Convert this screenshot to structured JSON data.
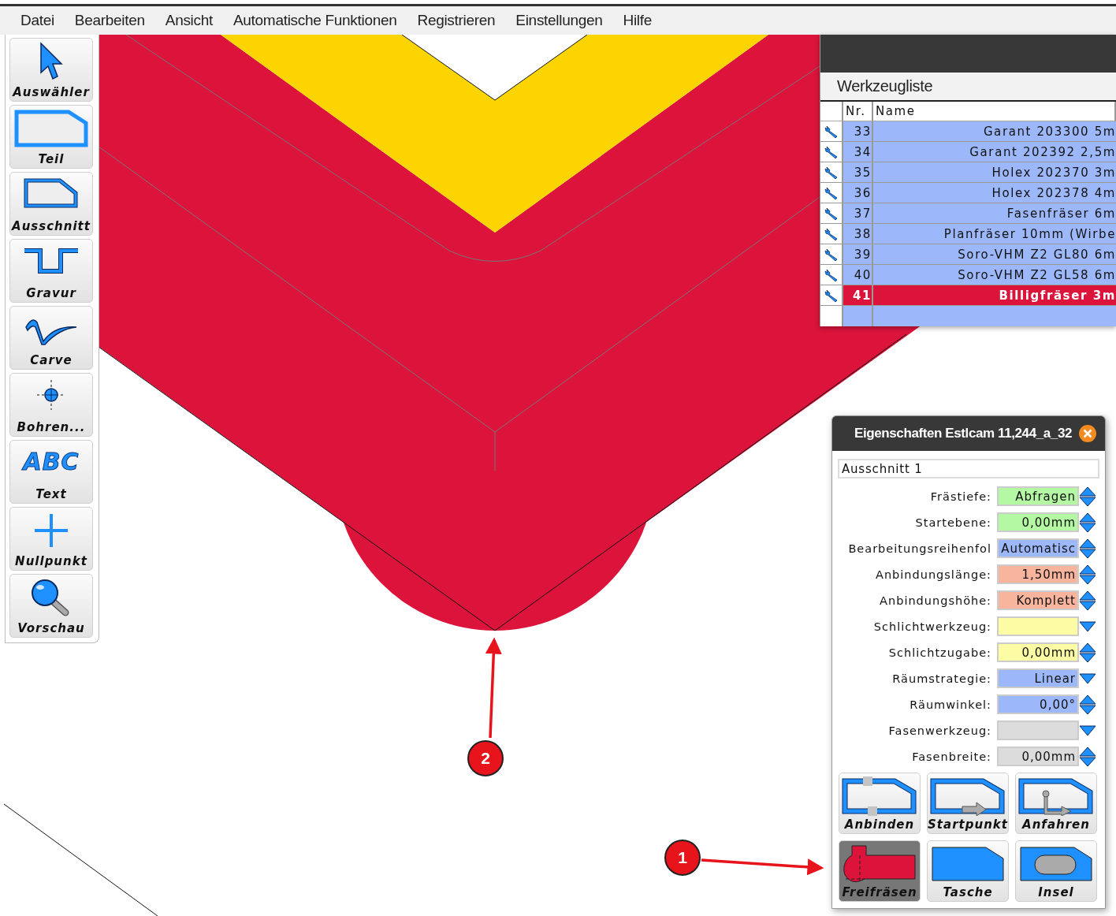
{
  "menu": [
    "Datei",
    "Bearbeiten",
    "Ansicht",
    "Automatische Funktionen",
    "Registrieren",
    "Einstellungen",
    "Hilfe"
  ],
  "toolbox": [
    {
      "label": "Auswähler",
      "kind": "arrow"
    },
    {
      "label": "Teil",
      "kind": "part"
    },
    {
      "label": "Ausschnitt",
      "kind": "cutout"
    },
    {
      "label": "Gravur",
      "kind": "engrave"
    },
    {
      "label": "Carve",
      "kind": "carve"
    },
    {
      "label": "Bohren...",
      "kind": "drill"
    },
    {
      "label": "Text",
      "kind": "text",
      "glyphs": "ABC"
    },
    {
      "label": "Nullpunkt",
      "kind": "origin"
    },
    {
      "label": "Vorschau",
      "kind": "preview"
    }
  ],
  "tool_list": {
    "title": "Werkzeugliste",
    "columns": [
      "Nr.",
      "Name"
    ],
    "rows": [
      {
        "nr": "33",
        "name": "Garant 203300 5m",
        "selected": false
      },
      {
        "nr": "34",
        "name": "Garant 202392 2,5m",
        "selected": false
      },
      {
        "nr": "35",
        "name": "Holex 202370 3m",
        "selected": false
      },
      {
        "nr": "36",
        "name": "Holex 202378 4m",
        "selected": false
      },
      {
        "nr": "37",
        "name": "Fasenfräser 6m",
        "selected": false
      },
      {
        "nr": "38",
        "name": "Planfräser 10mm (Wirbe",
        "selected": false
      },
      {
        "nr": "39",
        "name": "Soro-VHM Z2 GL80 6m",
        "selected": false
      },
      {
        "nr": "40",
        "name": "Soro-VHM Z2 GL58 6m",
        "selected": false
      },
      {
        "nr": "41",
        "name": "Billigfräser 3m",
        "selected": true
      }
    ]
  },
  "properties": {
    "title": "Eigenschaften Estlcam 11,244_a_32",
    "name": "Ausschnitt 1",
    "fields": [
      {
        "label": "Frästiefe:",
        "value": "Abfragen",
        "color": "#b4f8a4",
        "kind": "spin"
      },
      {
        "label": "Startebene:",
        "value": "0,00mm",
        "color": "#b4f8a4",
        "kind": "spin"
      },
      {
        "label": "Bearbeitungsreihenfol",
        "value": "Automatisc",
        "color": "#9cb8fa",
        "kind": "spin"
      },
      {
        "label": "Anbindungslänge:",
        "value": "1,50mm",
        "color": "#f8b49c",
        "kind": "spin"
      },
      {
        "label": "Anbindungshöhe:",
        "value": "Komplett",
        "color": "#f8b49c",
        "kind": "spin"
      },
      {
        "label": "Schlichtwerkzeug:",
        "color": "#fcfca4",
        "kind": "dropdown"
      },
      {
        "label": "Schlichtzugabe:",
        "value": "0,00mm",
        "color": "#fcfca4",
        "kind": "spin"
      },
      {
        "label": "Räumstrategie:",
        "value": "Linear",
        "color": "#9cb8fa",
        "kind": "dropdown"
      },
      {
        "label": "Räumwinkel:",
        "value": "0,00°",
        "color": "#9cb8fa",
        "kind": "spin"
      },
      {
        "label": "Fasenwerkzeug:",
        "color": "#dcdcdc",
        "kind": "dropdown"
      },
      {
        "label": "Fasenbreite:",
        "value": "0,00mm",
        "color": "#dcdcdc",
        "kind": "spin"
      }
    ],
    "buttons": [
      {
        "label": "Anbinden",
        "kind": "tabs",
        "selected": false
      },
      {
        "label": "Startpunkt",
        "kind": "start",
        "selected": false
      },
      {
        "label": "Anfahren",
        "kind": "approach",
        "selected": false
      },
      {
        "label": "Freifräsen",
        "kind": "clear",
        "selected": true
      },
      {
        "label": "Tasche",
        "kind": "pocket",
        "selected": false
      },
      {
        "label": "Insel",
        "kind": "island",
        "selected": false
      }
    ]
  },
  "callouts": [
    "2",
    "1"
  ]
}
